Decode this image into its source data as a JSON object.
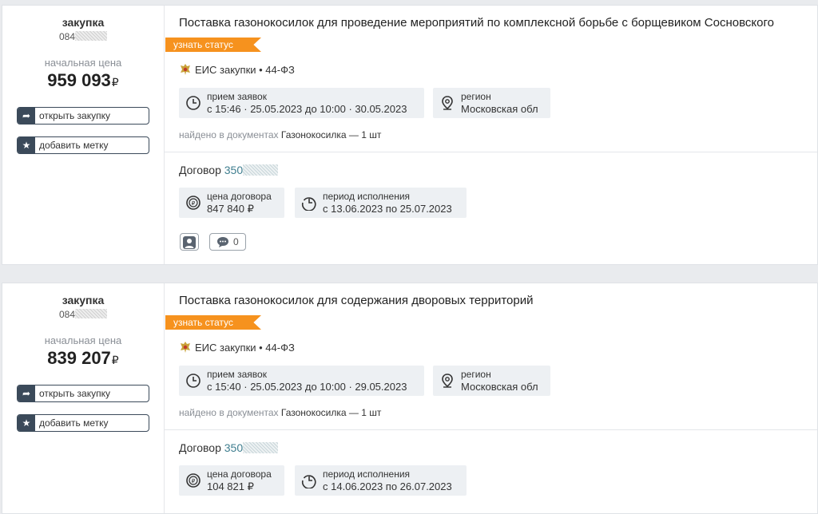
{
  "cards": [
    {
      "kind": "закупка",
      "number_prefix": "084",
      "price_label": "начальная цена",
      "price": "959 093",
      "currency": "₽",
      "open_label": "открыть закупку",
      "mark_label": "добавить метку",
      "title": "Поставка газонокосилок для проведение мероприятий по комплексной борьбе с борщевиком Сосновского",
      "status_label": "узнать статус",
      "source": "ЕИС закупки • 44-ФЗ",
      "accept_label": "прием заявок",
      "accept_value": "с 15:46 · 25.05.2023 до 10:00 · 30.05.2023",
      "region_label": "регион",
      "region_value": "Московская обл",
      "found_label": "найдено в документах",
      "found_value": "Газонокосилка — 1 шт",
      "contract_label": "Договор",
      "contract_number_prefix": "350",
      "contract_price_label": "цена договора",
      "contract_price_value": "847 840 ₽",
      "period_label": "период исполнения",
      "period_value": "с 13.06.2023 по 25.07.2023",
      "comments_count": "0"
    },
    {
      "kind": "закупка",
      "number_prefix": "084",
      "price_label": "начальная цена",
      "price": "839 207",
      "currency": "₽",
      "open_label": "открыть закупку",
      "mark_label": "добавить метку",
      "title": "Поставка газонокосилок для содержания дворовых территорий",
      "status_label": "узнать статус",
      "source": "ЕИС закупки • 44-ФЗ",
      "accept_label": "прием заявок",
      "accept_value": "с 15:40 · 25.05.2023 до 10:00 · 29.05.2023",
      "region_label": "регион",
      "region_value": "Московская обл",
      "found_label": "найдено в документах",
      "found_value": "Газонокосилка — 1 шт",
      "contract_label": "Договор",
      "contract_number_prefix": "350",
      "contract_price_label": "цена договора",
      "contract_price_value": "104 821 ₽",
      "period_label": "период исполнения",
      "period_value": "с 14.06.2023 по 26.07.2023"
    }
  ],
  "colors": {
    "status_orange": "#f6921e",
    "button_dark": "#3b4a5a",
    "contract_link": "#3f7e8f",
    "info_box_bg": "#edf0f3"
  }
}
